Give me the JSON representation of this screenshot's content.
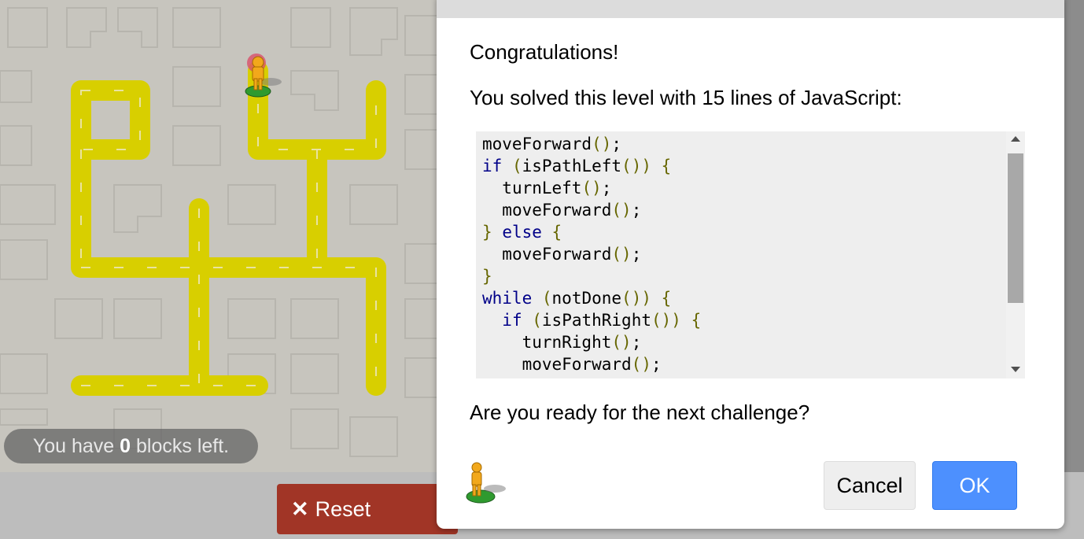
{
  "maze": {
    "blocks_message": {
      "prefix": "You have ",
      "count": "0",
      "suffix": " blocks left."
    },
    "reset_label": "Reset",
    "reset_icon": "close-x-icon"
  },
  "dialog": {
    "congrats": "Congratulations!",
    "solved_text": "You solved this level with 15 lines of JavaScript:",
    "code_lines": [
      "moveForward();",
      "if (isPathLeft()) {",
      "  turnLeft();",
      "  moveForward();",
      "} else {",
      "  moveForward();",
      "}",
      "while (notDone()) {",
      "  if (isPathRight()) {",
      "    turnRight();",
      "    moveForward();"
    ],
    "question": "Are you ready for the next challenge?",
    "cancel_label": "Cancel",
    "ok_label": "OK"
  },
  "colors": {
    "path": "#d8cf00",
    "reset": "#a13526",
    "ok": "#4d90fe",
    "keyword": "#000088",
    "punctuation": "#666600"
  }
}
